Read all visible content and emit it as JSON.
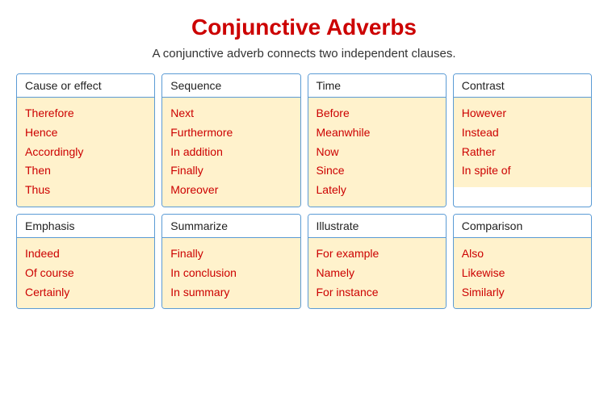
{
  "page": {
    "title": "Conjunctive Adverbs",
    "subtitle": "A conjunctive adverb connects two independent clauses."
  },
  "cards": [
    {
      "id": "cause-effect",
      "header": "Cause or effect",
      "items": [
        "Therefore",
        "Hence",
        "Accordingly",
        "Then",
        "Thus"
      ]
    },
    {
      "id": "sequence",
      "header": "Sequence",
      "items": [
        "Next",
        "Furthermore",
        "In addition",
        "Finally",
        "Moreover"
      ]
    },
    {
      "id": "time",
      "header": "Time",
      "items": [
        "Before",
        "Meanwhile",
        "Now",
        "Since",
        "Lately"
      ]
    },
    {
      "id": "contrast",
      "header": "Contrast",
      "items": [
        "However",
        "Instead",
        "Rather",
        "In spite of"
      ]
    },
    {
      "id": "emphasis",
      "header": "Emphasis",
      "items": [
        "Indeed",
        "Of course",
        "Certainly"
      ]
    },
    {
      "id": "summarize",
      "header": "Summarize",
      "items": [
        "Finally",
        "In conclusion",
        "In summary"
      ]
    },
    {
      "id": "illustrate",
      "header": "Illustrate",
      "items": [
        "For example",
        "Namely",
        "For instance"
      ]
    },
    {
      "id": "comparison",
      "header": "Comparison",
      "items": [
        "Also",
        "Likewise",
        "Similarly"
      ]
    }
  ]
}
